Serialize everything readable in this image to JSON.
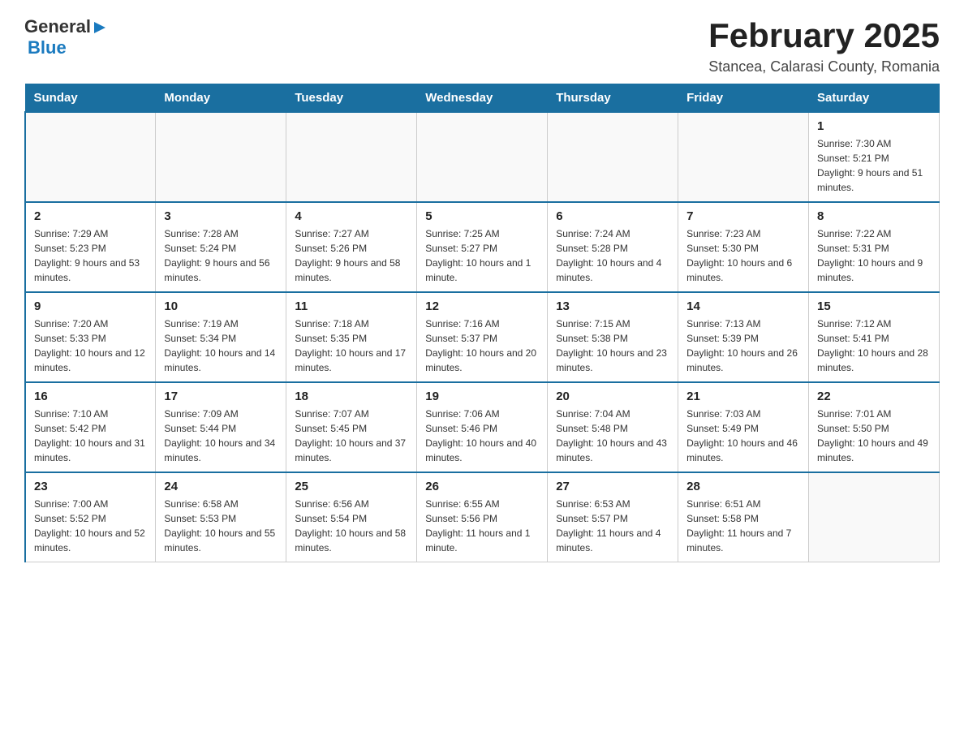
{
  "header": {
    "logo_general": "General",
    "logo_blue": "Blue",
    "title": "February 2025",
    "subtitle": "Stancea, Calarasi County, Romania"
  },
  "days_of_week": [
    "Sunday",
    "Monday",
    "Tuesday",
    "Wednesday",
    "Thursday",
    "Friday",
    "Saturday"
  ],
  "weeks": [
    [
      {
        "day": "",
        "info": ""
      },
      {
        "day": "",
        "info": ""
      },
      {
        "day": "",
        "info": ""
      },
      {
        "day": "",
        "info": ""
      },
      {
        "day": "",
        "info": ""
      },
      {
        "day": "",
        "info": ""
      },
      {
        "day": "1",
        "info": "Sunrise: 7:30 AM\nSunset: 5:21 PM\nDaylight: 9 hours and 51 minutes."
      }
    ],
    [
      {
        "day": "2",
        "info": "Sunrise: 7:29 AM\nSunset: 5:23 PM\nDaylight: 9 hours and 53 minutes."
      },
      {
        "day": "3",
        "info": "Sunrise: 7:28 AM\nSunset: 5:24 PM\nDaylight: 9 hours and 56 minutes."
      },
      {
        "day": "4",
        "info": "Sunrise: 7:27 AM\nSunset: 5:26 PM\nDaylight: 9 hours and 58 minutes."
      },
      {
        "day": "5",
        "info": "Sunrise: 7:25 AM\nSunset: 5:27 PM\nDaylight: 10 hours and 1 minute."
      },
      {
        "day": "6",
        "info": "Sunrise: 7:24 AM\nSunset: 5:28 PM\nDaylight: 10 hours and 4 minutes."
      },
      {
        "day": "7",
        "info": "Sunrise: 7:23 AM\nSunset: 5:30 PM\nDaylight: 10 hours and 6 minutes."
      },
      {
        "day": "8",
        "info": "Sunrise: 7:22 AM\nSunset: 5:31 PM\nDaylight: 10 hours and 9 minutes."
      }
    ],
    [
      {
        "day": "9",
        "info": "Sunrise: 7:20 AM\nSunset: 5:33 PM\nDaylight: 10 hours and 12 minutes."
      },
      {
        "day": "10",
        "info": "Sunrise: 7:19 AM\nSunset: 5:34 PM\nDaylight: 10 hours and 14 minutes."
      },
      {
        "day": "11",
        "info": "Sunrise: 7:18 AM\nSunset: 5:35 PM\nDaylight: 10 hours and 17 minutes."
      },
      {
        "day": "12",
        "info": "Sunrise: 7:16 AM\nSunset: 5:37 PM\nDaylight: 10 hours and 20 minutes."
      },
      {
        "day": "13",
        "info": "Sunrise: 7:15 AM\nSunset: 5:38 PM\nDaylight: 10 hours and 23 minutes."
      },
      {
        "day": "14",
        "info": "Sunrise: 7:13 AM\nSunset: 5:39 PM\nDaylight: 10 hours and 26 minutes."
      },
      {
        "day": "15",
        "info": "Sunrise: 7:12 AM\nSunset: 5:41 PM\nDaylight: 10 hours and 28 minutes."
      }
    ],
    [
      {
        "day": "16",
        "info": "Sunrise: 7:10 AM\nSunset: 5:42 PM\nDaylight: 10 hours and 31 minutes."
      },
      {
        "day": "17",
        "info": "Sunrise: 7:09 AM\nSunset: 5:44 PM\nDaylight: 10 hours and 34 minutes."
      },
      {
        "day": "18",
        "info": "Sunrise: 7:07 AM\nSunset: 5:45 PM\nDaylight: 10 hours and 37 minutes."
      },
      {
        "day": "19",
        "info": "Sunrise: 7:06 AM\nSunset: 5:46 PM\nDaylight: 10 hours and 40 minutes."
      },
      {
        "day": "20",
        "info": "Sunrise: 7:04 AM\nSunset: 5:48 PM\nDaylight: 10 hours and 43 minutes."
      },
      {
        "day": "21",
        "info": "Sunrise: 7:03 AM\nSunset: 5:49 PM\nDaylight: 10 hours and 46 minutes."
      },
      {
        "day": "22",
        "info": "Sunrise: 7:01 AM\nSunset: 5:50 PM\nDaylight: 10 hours and 49 minutes."
      }
    ],
    [
      {
        "day": "23",
        "info": "Sunrise: 7:00 AM\nSunset: 5:52 PM\nDaylight: 10 hours and 52 minutes."
      },
      {
        "day": "24",
        "info": "Sunrise: 6:58 AM\nSunset: 5:53 PM\nDaylight: 10 hours and 55 minutes."
      },
      {
        "day": "25",
        "info": "Sunrise: 6:56 AM\nSunset: 5:54 PM\nDaylight: 10 hours and 58 minutes."
      },
      {
        "day": "26",
        "info": "Sunrise: 6:55 AM\nSunset: 5:56 PM\nDaylight: 11 hours and 1 minute."
      },
      {
        "day": "27",
        "info": "Sunrise: 6:53 AM\nSunset: 5:57 PM\nDaylight: 11 hours and 4 minutes."
      },
      {
        "day": "28",
        "info": "Sunrise: 6:51 AM\nSunset: 5:58 PM\nDaylight: 11 hours and 7 minutes."
      },
      {
        "day": "",
        "info": ""
      }
    ]
  ]
}
